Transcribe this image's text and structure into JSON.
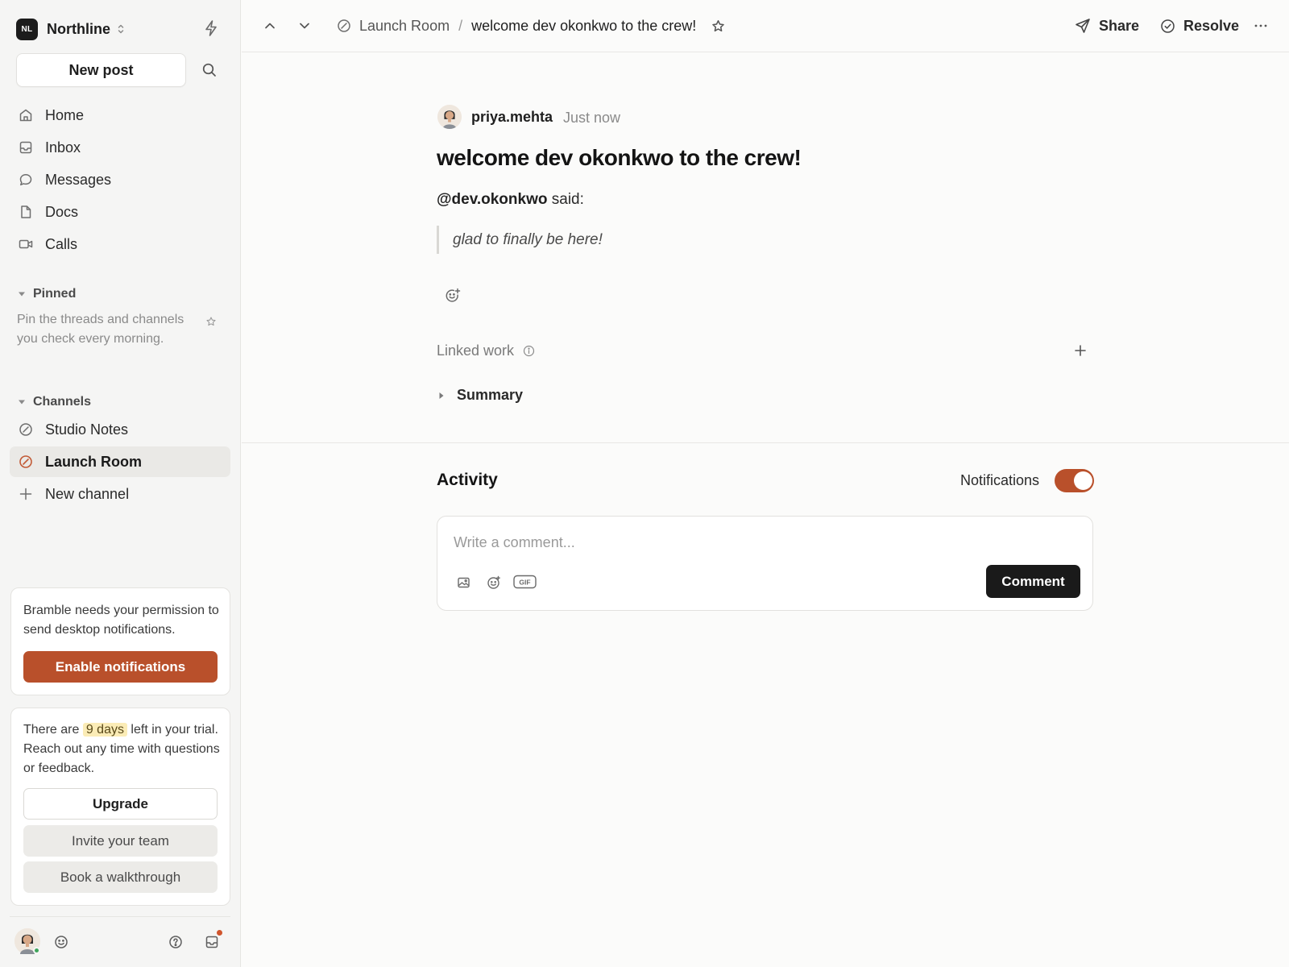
{
  "workspace": {
    "initials": "NL",
    "name": "Northline"
  },
  "sidebar": {
    "new_post_label": "New post",
    "nav": [
      {
        "label": "Home",
        "icon": "home-icon"
      },
      {
        "label": "Inbox",
        "icon": "inbox-icon"
      },
      {
        "label": "Messages",
        "icon": "message-icon"
      },
      {
        "label": "Docs",
        "icon": "doc-icon"
      },
      {
        "label": "Calls",
        "icon": "video-icon"
      }
    ],
    "pinned": {
      "title": "Pinned",
      "empty_text": "Pin the threads and channels you check every morning."
    },
    "channels": {
      "title": "Channels",
      "items": [
        {
          "label": "Studio Notes",
          "active": false
        },
        {
          "label": "Launch Room",
          "active": true
        }
      ],
      "new_channel_label": "New channel"
    },
    "permission_card": {
      "text": "Bramble needs your permission to send desktop notifications.",
      "button": "Enable notifications"
    },
    "trial_card": {
      "text_before": "There are",
      "days": "9 days",
      "text_after": "left in your trial. Reach out any time with questions or feedback.",
      "upgrade": "Upgrade",
      "invite": "Invite your team",
      "book": "Book a walkthrough"
    }
  },
  "topbar": {
    "breadcrumb_parent": "Launch Room",
    "breadcrumb_sep": "/",
    "breadcrumb_current": "welcome dev okonkwo to the crew!",
    "share": "Share",
    "resolve": "Resolve"
  },
  "post": {
    "author": "priya.mehta",
    "time": "Just now",
    "title": "welcome dev okonkwo to the crew!",
    "mention": "@dev.okonkwo",
    "said": " said:",
    "quote": "glad to finally be here!",
    "linked_work": "Linked work",
    "summary": "Summary"
  },
  "activity": {
    "title": "Activity",
    "notifications_label": "Notifications",
    "notifications_on": true,
    "comment_placeholder": "Write a comment...",
    "gif_label": "GIF",
    "comment_button": "Comment"
  },
  "colors": {
    "accent": "#b9502b",
    "dark_button": "#1a1a1a",
    "highlight": "#fbecb6",
    "online": "#3fa55b"
  }
}
